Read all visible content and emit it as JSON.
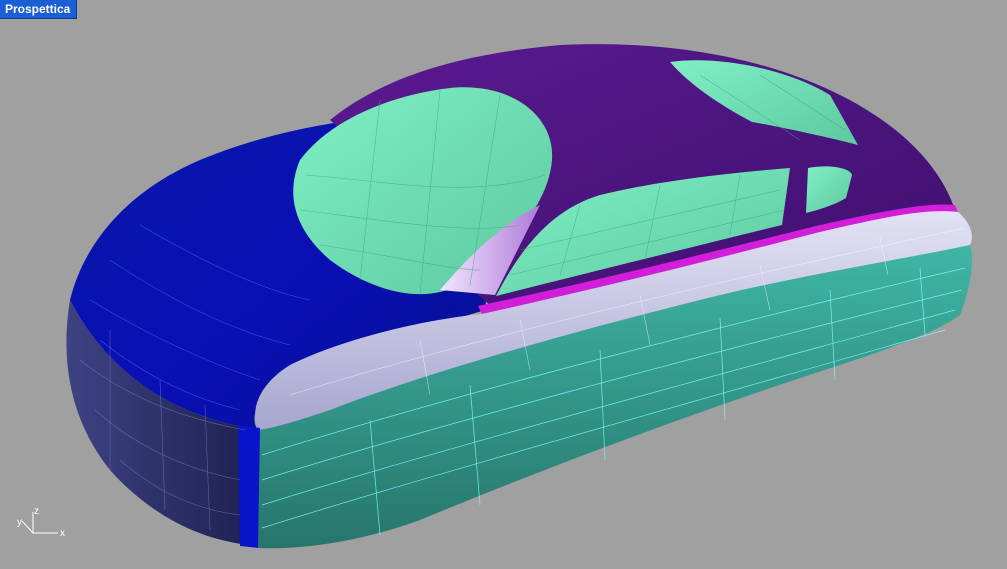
{
  "viewport": {
    "title": "Prospettica",
    "background": "#a0a0a0",
    "active_title_color": "#1a5fd6"
  },
  "axes": {
    "x_label": "x",
    "y_label": "y",
    "z_label": "z"
  },
  "model": {
    "colors": {
      "hood": "#0a0fa8",
      "roof": "#4b137e",
      "glass": "#6fe3b4",
      "side_lower": "#3aa89a",
      "side_upper": "#c8c8e6",
      "trim": "#d21ed8",
      "front_band": "#0a14c8",
      "nose": "#2a2f6a",
      "wire": "#7fffff"
    }
  }
}
